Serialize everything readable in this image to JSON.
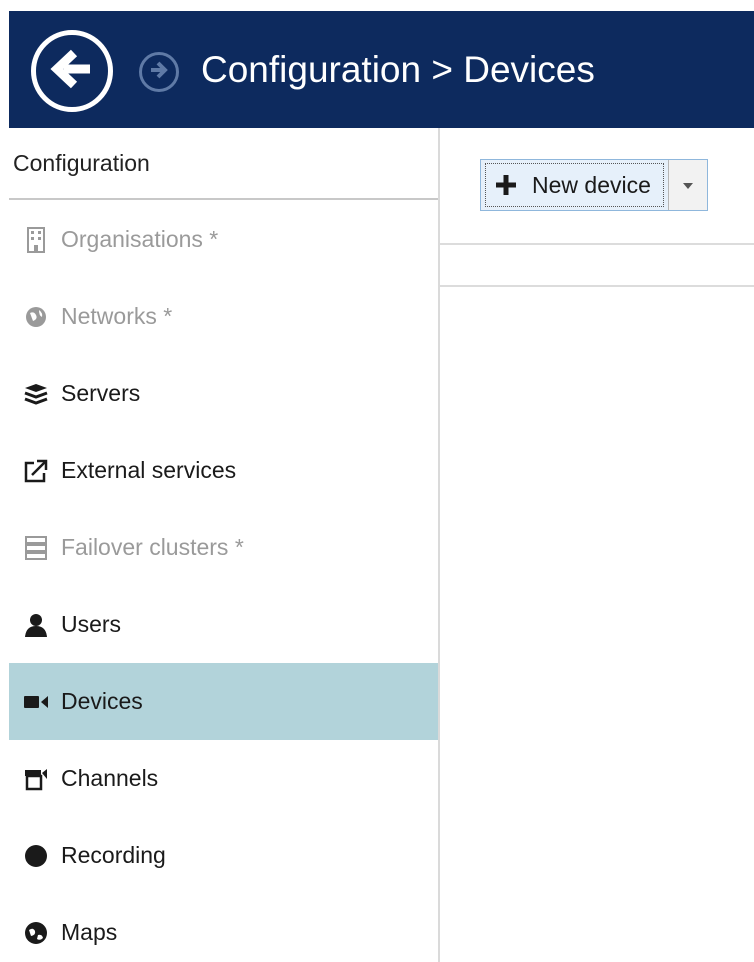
{
  "header": {
    "title": "Configuration > Devices",
    "back_icon": "arrow-left-circle-icon",
    "forward_icon": "arrow-right-circle-icon",
    "background_color": "#0d2a5e"
  },
  "sidebar": {
    "heading": "Configuration",
    "items": [
      {
        "label": "Organisations *",
        "icon": "building-icon",
        "disabled": true
      },
      {
        "label": "Networks *",
        "icon": "globe-icon",
        "disabled": true
      },
      {
        "label": "Servers",
        "icon": "server-stack-icon",
        "disabled": false
      },
      {
        "label": "External services",
        "icon": "external-link-icon",
        "disabled": false
      },
      {
        "label": "Failover clusters *",
        "icon": "cluster-icon",
        "disabled": true
      },
      {
        "label": "Users",
        "icon": "user-icon",
        "disabled": false
      },
      {
        "label": "Devices",
        "icon": "camera-icon",
        "disabled": false,
        "selected": true
      },
      {
        "label": "Channels",
        "icon": "channels-icon",
        "disabled": false
      },
      {
        "label": "Recording",
        "icon": "record-dot-icon",
        "disabled": false
      },
      {
        "label": "Maps",
        "icon": "map-globe-icon",
        "disabled": false
      }
    ],
    "selected_color": "#b2d3da"
  },
  "toolbar": {
    "new_device_label": "New device",
    "add_icon": "plus-icon",
    "dropdown_icon": "chevron-down-icon"
  }
}
